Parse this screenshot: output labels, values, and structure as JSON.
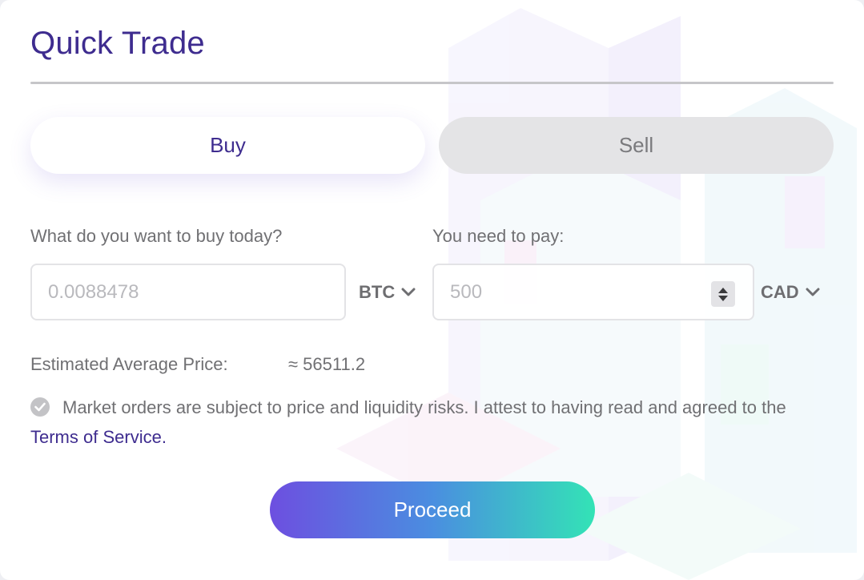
{
  "widget": {
    "title": "Quick Trade"
  },
  "tabs": [
    {
      "label": "Buy",
      "active": true
    },
    {
      "label": "Sell",
      "active": false
    }
  ],
  "buy_field": {
    "label": "What do you want to buy today?",
    "placeholder": "0.0088478",
    "currency": "BTC"
  },
  "pay_field": {
    "label": "You need to pay:",
    "placeholder": "500",
    "currency": "CAD"
  },
  "estimate": {
    "label": "Estimated Average Price:",
    "value": "≈ 56511.2"
  },
  "terms": {
    "text": "Market orders are subject to price and liquidity risks. I attest to having read and agreed to the ",
    "link_label": "Terms of Service."
  },
  "proceed_label": "Proceed",
  "icons": {
    "check": "check-circle-icon",
    "chevron": "chevron-down-icon",
    "stepper": "number-stepper-icon"
  },
  "colors": {
    "brand": "#3e2c8f",
    "gradient_start": "#6d4fe0",
    "gradient_end": "#33e3b6",
    "tab_inactive_bg": "#e4e4e6"
  }
}
